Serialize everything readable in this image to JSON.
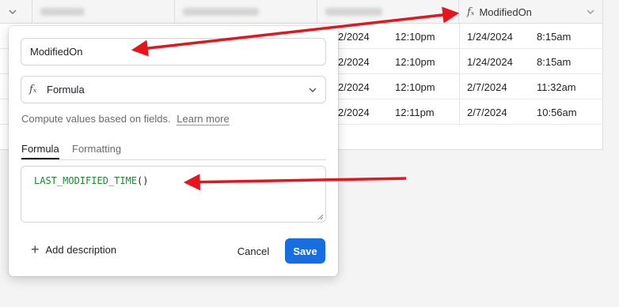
{
  "grid": {
    "header": {
      "field_name": "ModifiedOn",
      "field_icon": "formula-icon"
    },
    "rows": [
      {
        "date_a": "2/2024",
        "time_a": "12:10pm",
        "date_b": "1/24/2024",
        "time_b": "8:15am"
      },
      {
        "date_a": "2/2024",
        "time_a": "12:10pm",
        "date_b": "1/24/2024",
        "time_b": "8:15am"
      },
      {
        "date_a": "2/2024",
        "time_a": "12:10pm",
        "date_b": "2/7/2024",
        "time_b": "11:32am"
      },
      {
        "date_a": "2/2024",
        "time_a": "12:11pm",
        "date_b": "2/7/2024",
        "time_b": "10:56am"
      }
    ]
  },
  "dialog": {
    "field_name_value": "ModifiedOn",
    "field_type": "Formula",
    "description_text": "Compute values based on fields.",
    "learn_more": "Learn more",
    "tabs": [
      {
        "label": "Formula",
        "active": true
      },
      {
        "label": "Formatting",
        "active": false
      }
    ],
    "formula_fn": "LAST_MODIFIED_TIME",
    "formula_parens": "()",
    "add_description": "Add description",
    "cancel": "Cancel",
    "save": "Save"
  },
  "colors": {
    "save_button": "#166ee1",
    "formula_text": "#1b8a2f",
    "annotation_arrow": "#e8141b"
  }
}
